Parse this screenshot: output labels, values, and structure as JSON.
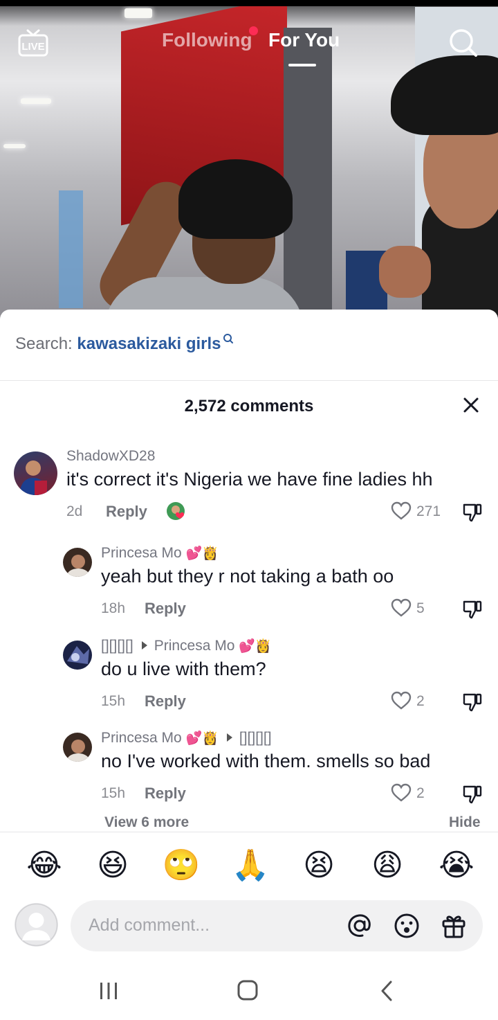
{
  "top_nav": {
    "live_label": "LIVE",
    "tabs": [
      {
        "label": "Following",
        "active": false,
        "has_notification_dot": true
      },
      {
        "label": "For You",
        "active": true
      }
    ],
    "search_icon": "search-icon"
  },
  "comments_sheet": {
    "search_suggestion": {
      "prefix": "Search:",
      "term": "kawasakizaki girls"
    },
    "comment_count": "2,572 comments",
    "comments": [
      {
        "username": "ShadowXD28",
        "text": "it's correct it's Nigeria we have fine ladies hh",
        "time": "2d",
        "reply_label": "Reply",
        "likes": "271",
        "liked_by_creator": true
      },
      {
        "username": "Princesa Mo",
        "username_emoji": "💕👸",
        "text": "yeah but they r not taking a bath oo",
        "time": "18h",
        "reply_label": "Reply",
        "likes": "5"
      },
      {
        "username": "[][][][]",
        "reply_to": "Princesa Mo",
        "reply_to_emoji": "💕👸",
        "text": "do u live with them?",
        "time": "15h",
        "reply_label": "Reply",
        "likes": "2"
      },
      {
        "username": "Princesa Mo",
        "username_emoji": "💕👸",
        "reply_to": "[][][][]",
        "text": "no I've worked with them. smells so bad",
        "time": "15h",
        "reply_label": "Reply",
        "likes": "2"
      }
    ],
    "view_more_label": "View 6 more",
    "hide_label": "Hide",
    "quick_emojis": [
      "😂",
      "😆",
      "🙄",
      "🙏",
      "😫",
      "😩",
      "😭"
    ],
    "input": {
      "placeholder": "Add comment..."
    }
  },
  "colors": {
    "accent_red": "#fe2c55",
    "link_blue": "#2b5a9e",
    "text_primary": "#161823",
    "text_secondary": "#747680"
  }
}
